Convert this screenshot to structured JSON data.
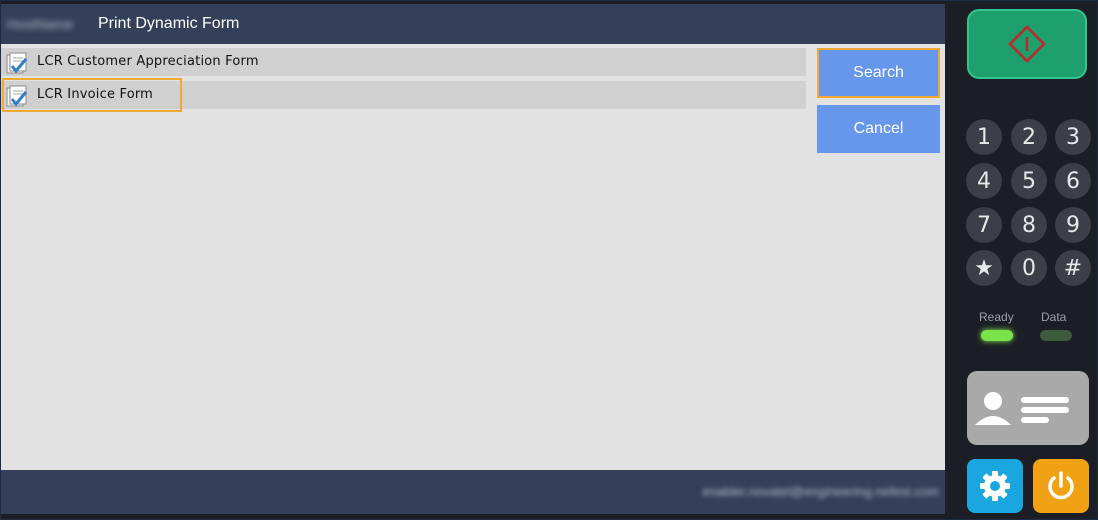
{
  "header": {
    "blurred_name": "HostName",
    "title": "Print Dynamic Form"
  },
  "forms": [
    {
      "label": "LCR Customer Appreciation Form",
      "selected": false
    },
    {
      "label": "LCR Invoice Form",
      "selected": true
    }
  ],
  "buttons": {
    "search": "Search",
    "cancel": "Cancel"
  },
  "footer": {
    "user": "enabler.novatel@engineering.nefest.com"
  },
  "keypad": {
    "keys": [
      "1",
      "2",
      "3",
      "4",
      "5",
      "6",
      "7",
      "8",
      "9",
      "★",
      "0",
      "#"
    ]
  },
  "indicators": {
    "ready": "Ready",
    "data": "Data"
  },
  "colors": {
    "accent_blue": "#6797ea",
    "highlight": "#f1a934",
    "start_green": "#1e9f6e",
    "header_bg": "#34405a"
  }
}
